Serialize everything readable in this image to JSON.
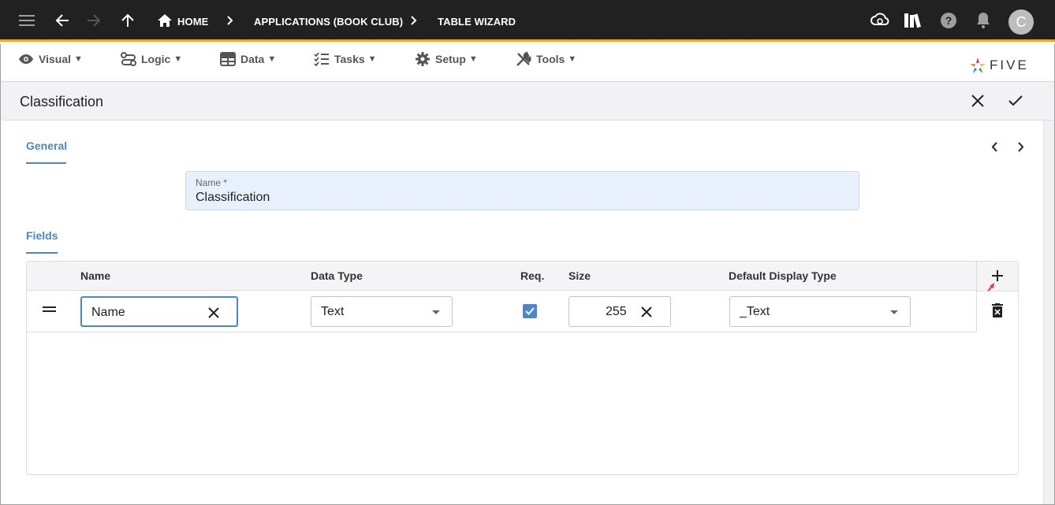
{
  "topbar": {
    "breadcrumbs": [
      "HOME",
      "APPLICATIONS (BOOK CLUB)",
      "TABLE WIZARD"
    ],
    "avatar_initial": "C"
  },
  "menu": {
    "items": [
      {
        "label": "Visual",
        "icon": "eye-icon"
      },
      {
        "label": "Logic",
        "icon": "flow-icon"
      },
      {
        "label": "Data",
        "icon": "table-icon"
      },
      {
        "label": "Tasks",
        "icon": "checklist-icon"
      },
      {
        "label": "Setup",
        "icon": "gear-icon"
      },
      {
        "label": "Tools",
        "icon": "tools-icon"
      }
    ],
    "caret": "▼",
    "logo_text": "FIVE"
  },
  "form": {
    "title": "Classification"
  },
  "tabs": {
    "general": "General",
    "fields": "Fields"
  },
  "name_field": {
    "label": "Name *",
    "value": "Classification"
  },
  "grid": {
    "headers": {
      "name": "Name",
      "data_type": "Data Type",
      "req": "Req.",
      "size": "Size",
      "display_type": "Default Display Type"
    },
    "rows": [
      {
        "name": "Name",
        "data_type": "Text",
        "required": true,
        "size": "255",
        "display_type": "_Text"
      }
    ]
  },
  "colors": {
    "topbar": "#212121",
    "accent_orange": "#f5a623",
    "accent_blue": "#4a86c8"
  }
}
